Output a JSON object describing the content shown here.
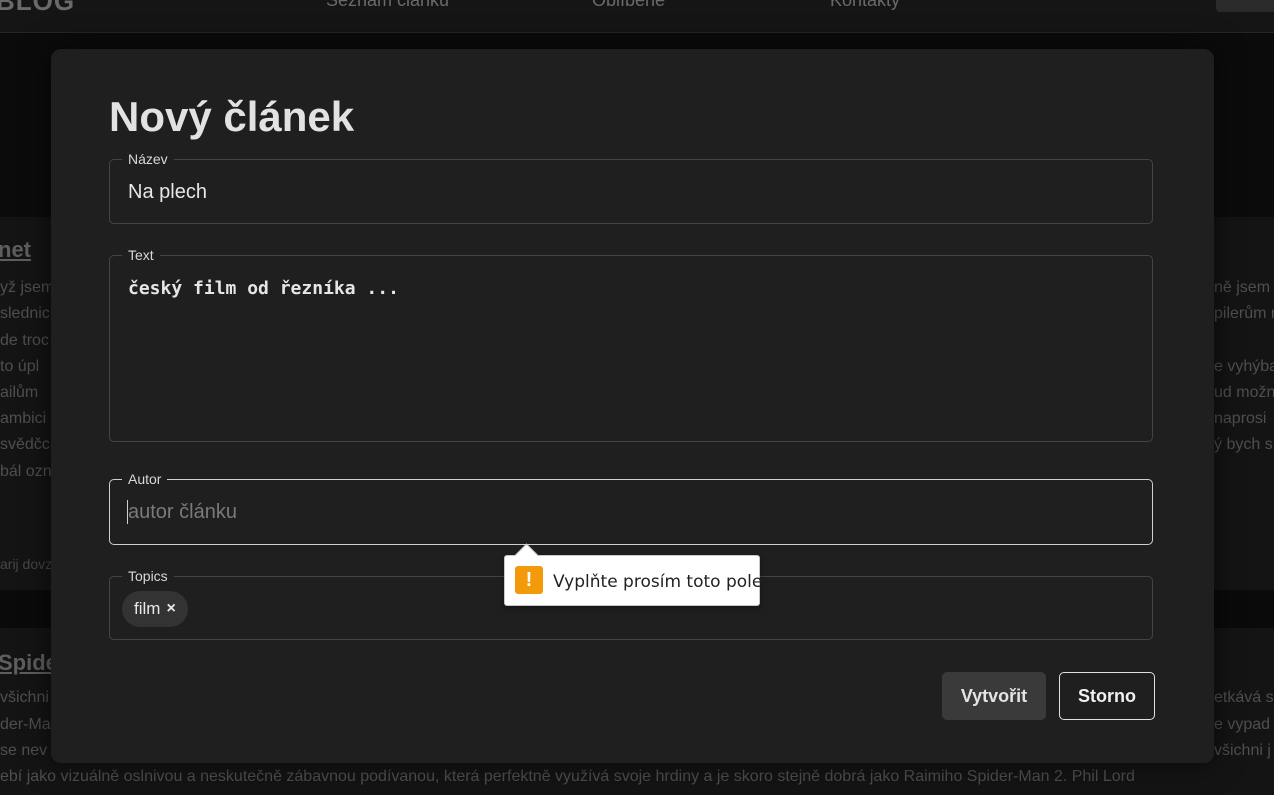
{
  "background": {
    "brand": "BLOG",
    "nav": [
      "Seznam článků",
      "Oblíbené",
      "Kontakty"
    ],
    "articles": [
      {
        "title": "net",
        "left_fragments": [
          "yž jsem",
          "slednic",
          "de troc",
          "to úpl",
          "ailům",
          "ambici",
          "svědčc",
          "bál ozn"
        ],
        "right_fragments": [
          "ně jsem",
          "pilerům n",
          "e vyhýba",
          "ud možn",
          "naprosi",
          "ý bych s"
        ],
        "footer": "arij dovz"
      },
      {
        "title": "Spiderm",
        "left_fragments": [
          "všichni",
          "der-Ma",
          "se nev"
        ],
        "right_fragments": [
          "etkává s",
          "e vypad",
          "všichni j"
        ],
        "last_line": "ebí jako vizuálně oslnivou a neskutečně zábavnou podívanou, která perfektně využívá svoje hrdiny a je skoro stejně dobrá jako Raimiho Spider-Man 2. Phil Lord"
      }
    ]
  },
  "modal": {
    "title": "Nový článek",
    "fields": {
      "nazev": {
        "label": "Název",
        "value": "Na plech"
      },
      "text": {
        "label": "Text",
        "value": "český film od řezníka ..."
      },
      "autor": {
        "label": "Autor",
        "value": "",
        "placeholder": "autor článku"
      },
      "topics": {
        "label": "Topics",
        "chips": [
          {
            "label": "film",
            "remove": "×"
          }
        ]
      }
    },
    "buttons": {
      "create": "Vytvořit",
      "cancel": "Storno"
    }
  },
  "validation": {
    "icon": "!",
    "message": "Vyplňte prosím toto pole.",
    "icon_color": "#f39a0b"
  }
}
